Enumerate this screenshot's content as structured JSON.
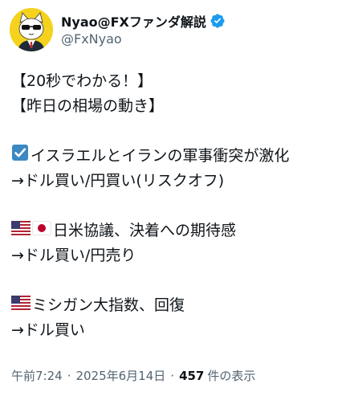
{
  "author": {
    "display_name": "Nyao@FXファンダ解説",
    "handle": "@FxNyao"
  },
  "post": {
    "lines": [
      "【20秒でわかる！】",
      "【昨日の相場の動き】",
      "",
      "イスラエルとイランの軍事衝突が激化",
      "→ドル買い/円買い(リスクオフ)",
      "",
      "日米協議、決着への期待感",
      "→ドル買い/円売り",
      "",
      "ミシガン大指数、回復",
      "→ドル買い"
    ],
    "emojis": {
      "check": "check-box-emoji",
      "us_flag": "us-flag-emoji",
      "jp_flag": "jp-flag-emoji"
    }
  },
  "meta": {
    "time": "午前7:24",
    "separator": "·",
    "date": "2025年6月14日",
    "views_count": "457",
    "views_label": "件の表示"
  },
  "colors": {
    "text": "#0f1419",
    "secondary": "#536471",
    "verified": "#1d9bf0",
    "check_emoji": "#3b88c3",
    "avatar_bg": "#f4d21e"
  }
}
